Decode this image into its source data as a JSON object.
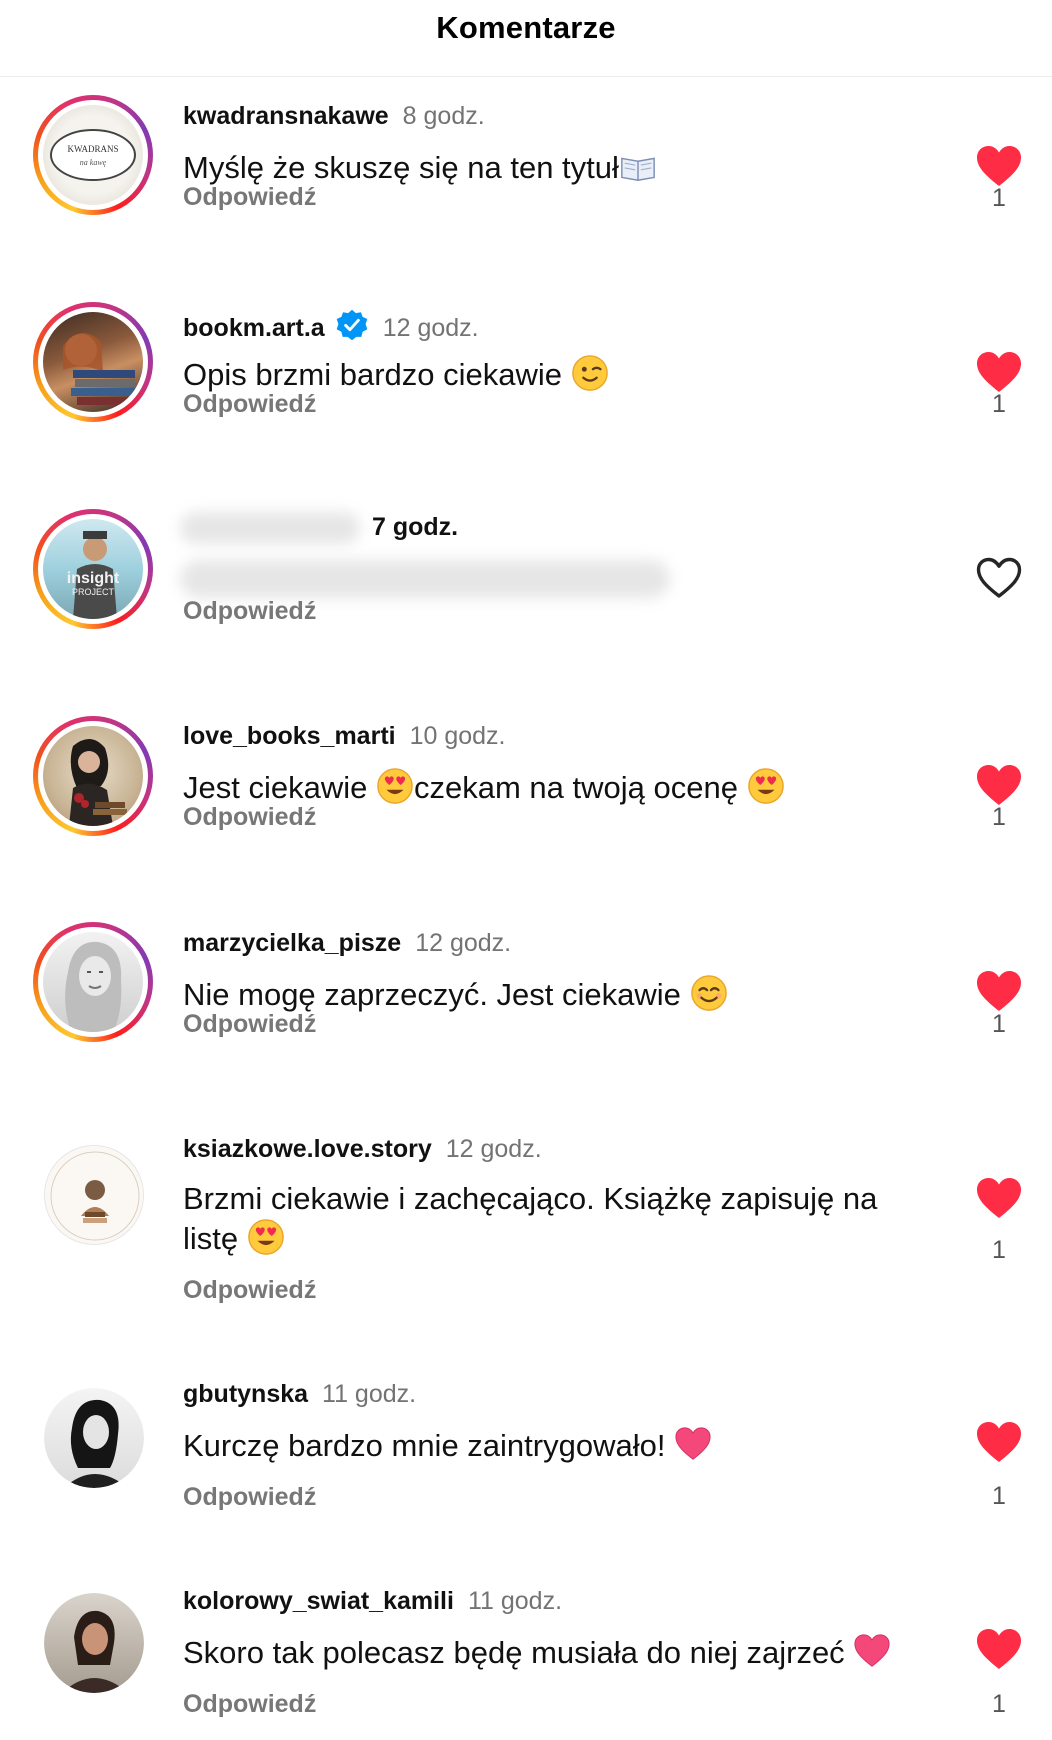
{
  "header": {
    "title": "Komentarze"
  },
  "colors": {
    "like": "#fe2c44",
    "muted": "#737373",
    "verified": "#0095f6"
  },
  "comments": [
    {
      "username": "kwadransnakawe",
      "time": "8 godz.",
      "text": "Myślę że skuszę się na ten tytuł",
      "emoji": "book-emoji",
      "reply": "Odpowiedź",
      "liked": true,
      "likes": "1",
      "avatar_text": "KWADRANS na kawę"
    },
    {
      "username": "bookm.art.a",
      "time": "12 godz.",
      "text": "Opis brzmi bardzo ciekawie",
      "emoji": "wink-emoji",
      "reply": "Odpowiedź",
      "liked": true,
      "likes": "1",
      "verified": true
    },
    {
      "username": "",
      "time": "7 godz.",
      "text": "",
      "reply": "Odpowiedź",
      "liked": false,
      "likes": ""
    },
    {
      "username": "love_books_marti",
      "time": "10 godz.",
      "text_a": "Jest ciekawie",
      "text_b": "czekam na twoją ocenę",
      "emoji": "heart-eyes-emoji",
      "reply": "Odpowiedź",
      "liked": true,
      "likes": "1"
    },
    {
      "username": "marzycielka_pisze",
      "time": "12 godz.",
      "text": "Nie mogę zaprzeczyć. Jest ciekawie",
      "emoji": "smile-emoji",
      "reply": "Odpowiedź",
      "liked": true,
      "likes": "1"
    },
    {
      "username": "ksiazkowe.love.story",
      "time": "12 godz.",
      "text_a": "Brzmi ciekawie i zachęcająco. Książkę zapisuję na",
      "text_b": "listę",
      "emoji": "heart-eyes-emoji",
      "reply": "Odpowiedź",
      "liked": true,
      "likes": "1"
    },
    {
      "username": "gbutynska",
      "time": "11 godz.",
      "text": "Kurczę bardzo mnie zaintrygowało!",
      "emoji": "pink-heart-emoji",
      "reply": "Odpowiedź",
      "liked": true,
      "likes": "1"
    },
    {
      "username": "kolorowy_swiat_kamili",
      "time": "11 godz.",
      "text": "Skoro tak polecasz będę musiała do niej zajrzeć",
      "emoji": "pink-heart-emoji",
      "reply": "Odpowiedź",
      "liked": true,
      "likes": "1"
    }
  ]
}
